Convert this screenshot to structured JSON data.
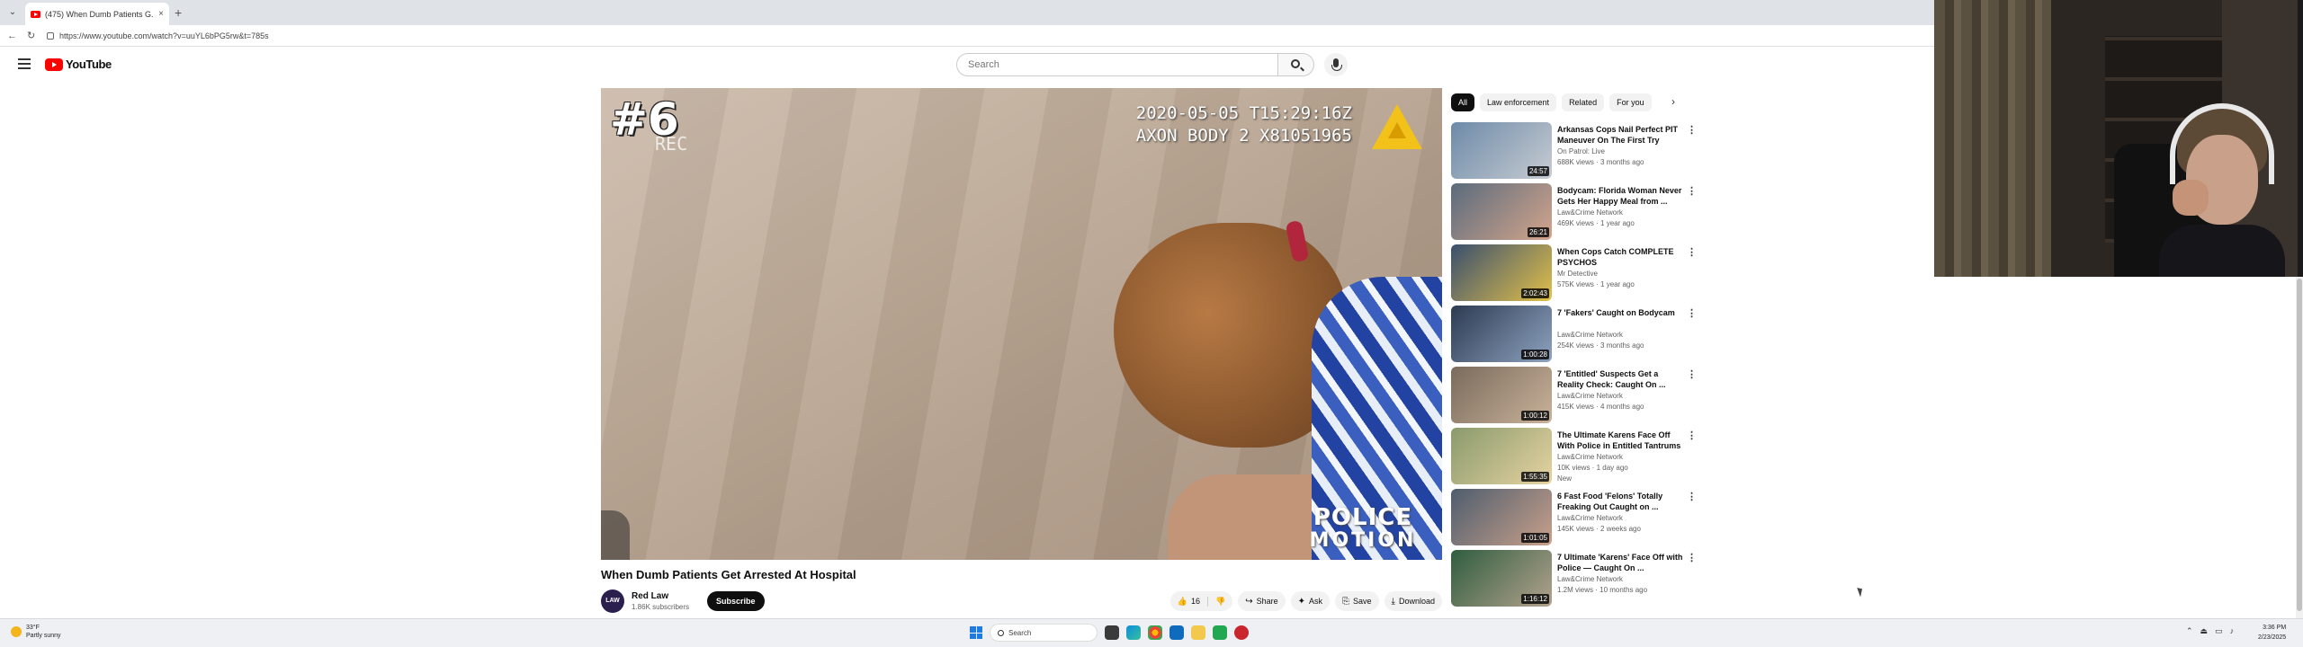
{
  "browser": {
    "tab_title": "(475) When Dumb Patients G...",
    "tab_close": "×",
    "new_tab": "+",
    "url": "https://www.youtube.com/watch?v=uuYL6bPG5rw&t=785s",
    "back": "←",
    "reload": "↻"
  },
  "masthead": {
    "logo_text": "YouTube",
    "search_placeholder": "Search"
  },
  "video": {
    "overlay_rank": "#6",
    "overlay_rec": "REC",
    "overlay_timestamp_line1": "2020-05-05 T15:29:16Z",
    "overlay_timestamp_line2": "AXON BODY 2 X81051965",
    "watermark_line1": "POLICE",
    "watermark_line2": "MOTION",
    "title": "When Dumb Patients Get Arrested At Hospital",
    "channel_avatar_text": "LAW",
    "channel_name": "Red Law",
    "channel_subs": "1.86K subscribers",
    "subscribe_label": "Subscribe",
    "like_count": "16",
    "share_label": "Share",
    "ask_label": "Ask",
    "save_label": "Save",
    "download_label": "Download"
  },
  "sidebar": {
    "chips": [
      "All",
      "Law enforcement",
      "Related",
      "For you"
    ],
    "chip_next": "›",
    "items": [
      {
        "title": "Arkansas Cops Nail Perfect PIT Maneuver On The First Try",
        "channel": "On Patrol: Live",
        "meta": "688K views · 3 months ago",
        "duration": "24:57",
        "badge": "",
        "colors": [
          "#6d8aa8",
          "#c7ccd3"
        ]
      },
      {
        "title": "Bodycam: Florida Woman Never Gets Her Happy Meal from ...",
        "channel": "Law&Crime Network",
        "meta": "469K views · 1 year ago",
        "duration": "26:21",
        "badge": "",
        "colors": [
          "#5a6b7c",
          "#d4a58c"
        ]
      },
      {
        "title": "When Cops Catch COMPLETE PSYCHOS",
        "channel": "Mr Detective",
        "meta": "575K views · 1 year ago",
        "duration": "2:02:43",
        "badge": "",
        "colors": [
          "#3a4f6e",
          "#e2c14a"
        ]
      },
      {
        "title": "7 'Fakers' Caught on Bodycam",
        "channel": "Law&Crime Network",
        "meta": "254K views · 3 months ago",
        "duration": "1:00:28",
        "badge": "",
        "colors": [
          "#2d3a52",
          "#8ea3bf"
        ]
      },
      {
        "title": "7 'Entitled' Suspects Get a Reality Check: Caught On ...",
        "channel": "Law&Crime Network",
        "meta": "415K views · 4 months ago",
        "duration": "1:00:12",
        "badge": "",
        "colors": [
          "#7a6b5c",
          "#c9b29a"
        ]
      },
      {
        "title": "The Ultimate Karens Face Off With Police in Entitled Tantrums",
        "channel": "Law&Crime Network",
        "meta": "10K views · 1 day ago",
        "duration": "1:55:35",
        "badge": "New",
        "colors": [
          "#8a9a6d",
          "#e6d3a1"
        ]
      },
      {
        "title": "6 Fast Food 'Felons' Totally Freaking Out Caught on ...",
        "channel": "Law&Crime Network",
        "meta": "145K views · 2 weeks ago",
        "duration": "1:01:05",
        "badge": "",
        "colors": [
          "#4e5d6e",
          "#c8a08a"
        ]
      },
      {
        "title": "7 Ultimate 'Karens' Face Off with Police — Caught On ...",
        "channel": "Law&Crime Network",
        "meta": "1.2M views · 10 months ago",
        "duration": "1:16:12",
        "badge": "",
        "colors": [
          "#2f5d3f",
          "#b3a28d"
        ]
      }
    ]
  },
  "taskbar": {
    "weather_temp": "33°F",
    "weather_desc": "Partly sunny",
    "search_placeholder": "Search",
    "time": "3:36 PM",
    "date": "2/23/2025"
  }
}
